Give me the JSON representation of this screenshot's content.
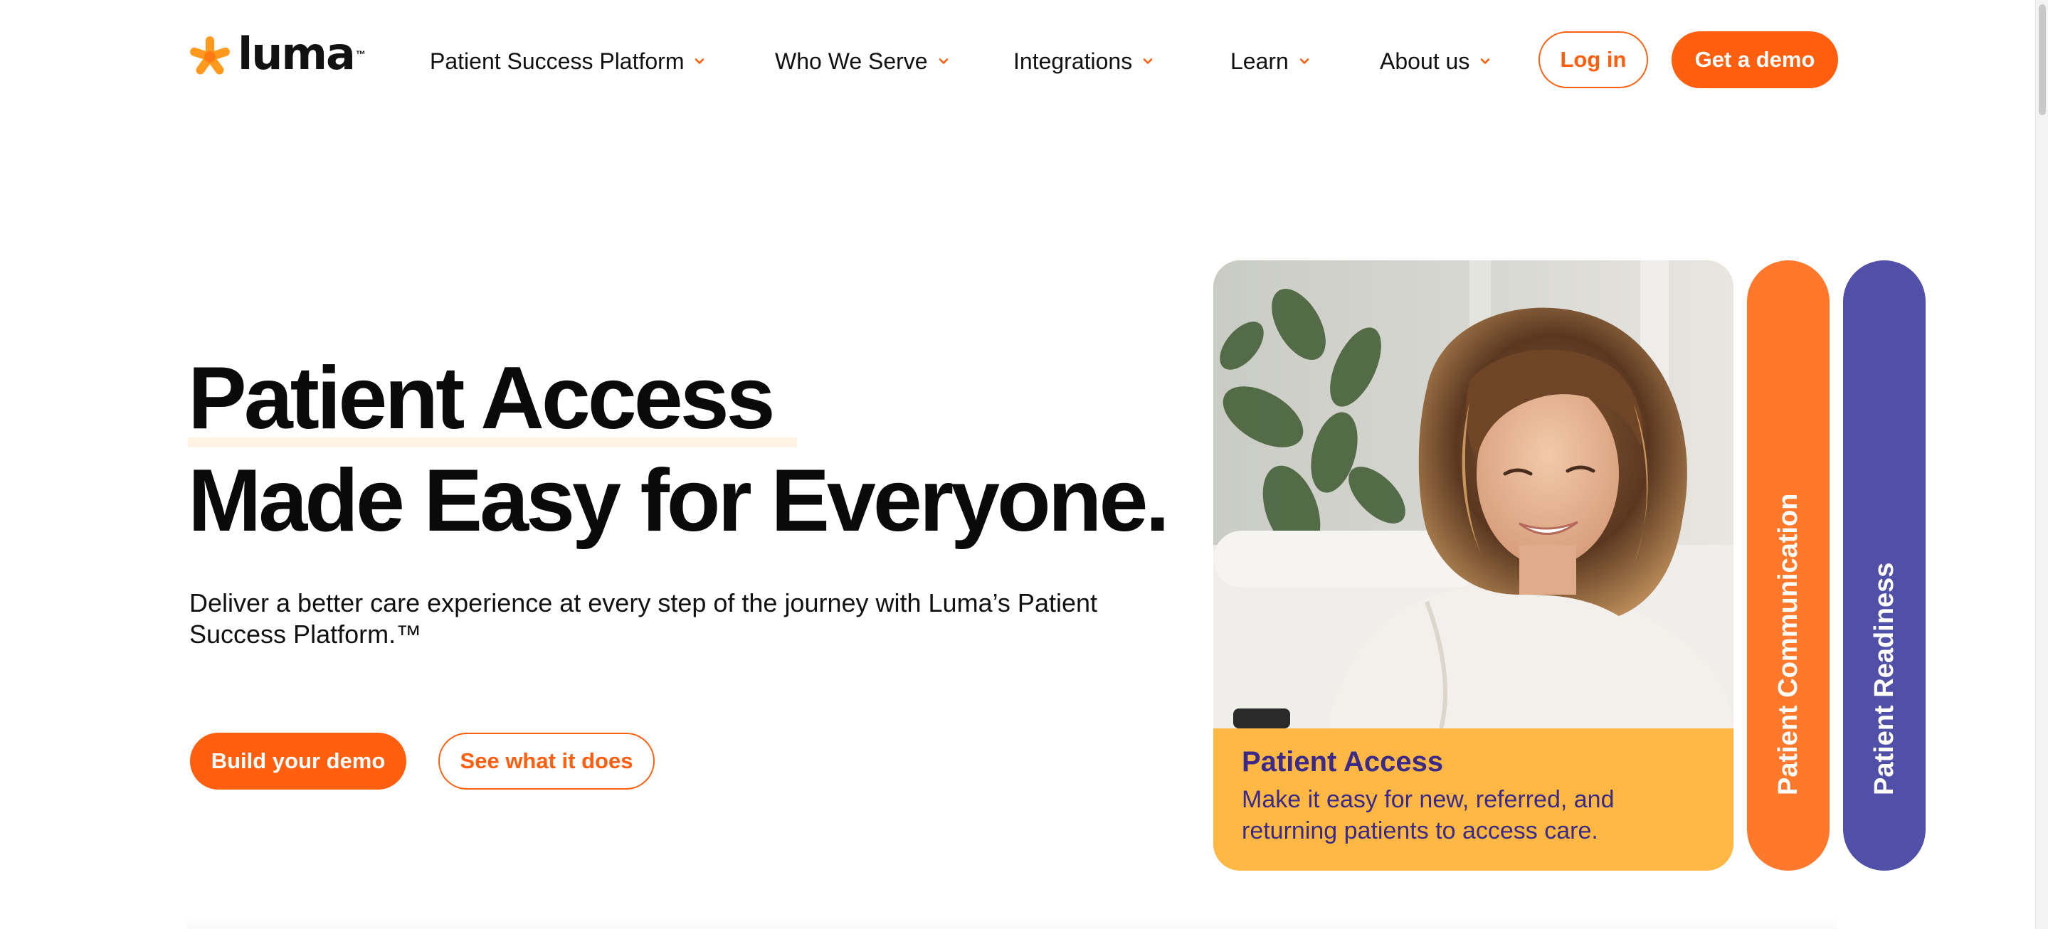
{
  "brand": {
    "name": "luma",
    "trademark": "™",
    "accent_color": "#ff5f0f",
    "logo_icon": "asterisk-star-icon"
  },
  "nav": {
    "items": [
      {
        "label": "Patient Success Platform",
        "icon": "chevron-down-icon"
      },
      {
        "label": "Who We Serve",
        "icon": "chevron-down-icon"
      },
      {
        "label": "Integrations",
        "icon": "chevron-down-icon"
      },
      {
        "label": "Learn",
        "icon": "chevron-down-icon"
      },
      {
        "label": "About us",
        "icon": "chevron-down-icon"
      }
    ],
    "login_label": "Log in",
    "demo_label": "Get a demo"
  },
  "hero": {
    "title_line1": "Patient Access",
    "title_line2": "Made Easy for Everyone.",
    "subtitle": "Deliver a better care experience at every step of the journey with Luma’s Patient Success Platform.™",
    "primary_cta": "Build your demo",
    "secondary_cta": "See what it does"
  },
  "cards": {
    "main": {
      "title": "Patient Access",
      "text": "Make it easy for new, referred, and returning patients to access care.",
      "color": "#ffb843",
      "text_color": "#3b2a86"
    },
    "communication": {
      "label": "Patient Communication",
      "color": "#ff782b"
    },
    "readiness": {
      "label": "Patient Readiness",
      "color": "#5050a8"
    }
  }
}
